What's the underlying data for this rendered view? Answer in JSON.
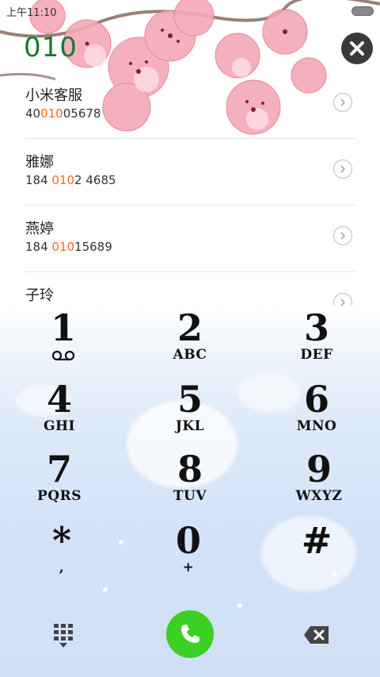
{
  "status_bar": {
    "time": "上午11:10"
  },
  "dialer": {
    "input": "010"
  },
  "results": [
    {
      "name": "小米客服",
      "number_pre": "40",
      "number_match": "010",
      "number_post": "05678"
    },
    {
      "name": "雅娜",
      "number_pre": "184 ",
      "number_match": "010",
      "number_post": "2 4685"
    },
    {
      "name": "燕婷",
      "number_pre": "184 ",
      "number_match": "010",
      "number_post": "15689"
    },
    {
      "name": "子玲",
      "number_pre": "",
      "number_match": "",
      "number_post": ""
    }
  ],
  "keypad": {
    "keys": [
      {
        "digit": "1",
        "letters": ""
      },
      {
        "digit": "2",
        "letters": "ABC"
      },
      {
        "digit": "3",
        "letters": "DEF"
      },
      {
        "digit": "4",
        "letters": "GHI"
      },
      {
        "digit": "5",
        "letters": "JKL"
      },
      {
        "digit": "6",
        "letters": "MNO"
      },
      {
        "digit": "7",
        "letters": "PQRS"
      },
      {
        "digit": "8",
        "letters": "TUV"
      },
      {
        "digit": "9",
        "letters": "WXYZ"
      },
      {
        "digit": "*",
        "letters": ","
      },
      {
        "digit": "0",
        "letters": "+"
      },
      {
        "digit": "#",
        "letters": ""
      }
    ]
  },
  "colors": {
    "dialed_text": "#1a7a2e",
    "match_highlight": "#ff6a1a",
    "call_button": "#3ccf24",
    "close_button": "#3a3a3a"
  },
  "icons": {
    "close": "close-icon",
    "details": "chevron-right-icon",
    "voicemail": "voicemail-icon",
    "keypad": "dialpad-icon",
    "call": "phone-icon",
    "delete": "backspace-icon"
  }
}
